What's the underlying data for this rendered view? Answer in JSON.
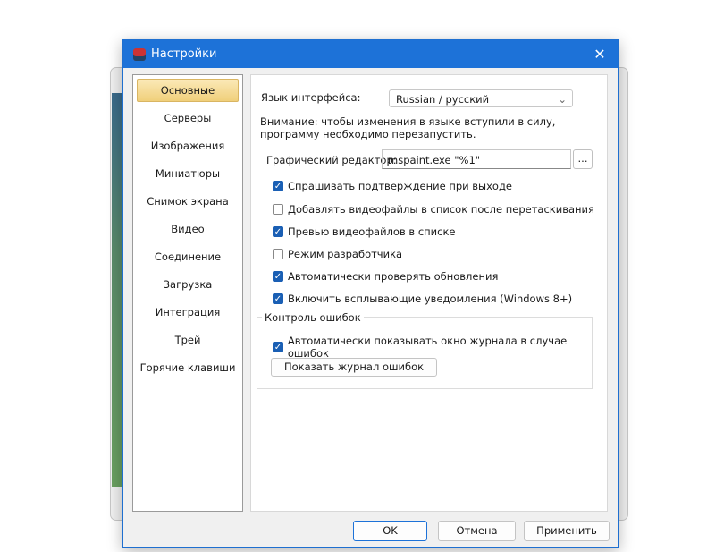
{
  "dialog": {
    "title": "Настройки"
  },
  "sidebar": {
    "items": [
      "Основные",
      "Серверы",
      "Изображения",
      "Миниатюры",
      "Снимок экрана",
      "Видео",
      "Соединение",
      "Загрузка",
      "Интеграция",
      "Трей",
      "Горячие клавиши"
    ]
  },
  "general": {
    "language_label": "Язык интерфейса:",
    "language_value": "Russian / русский",
    "warning": "Внимание: чтобы изменения в языке вступили в силу, программу необходимо перезапустить.",
    "editor_label": "Графический редактор:",
    "editor_value": "mspaint.exe \"%1\"",
    "browse": "...",
    "checkboxes": [
      {
        "label": "Спрашивать подтверждение при выходе",
        "checked": true
      },
      {
        "label": "Добавлять видеофайлы в список после перетаскивания",
        "checked": false
      },
      {
        "label": "Превью видеофайлов в списке",
        "checked": true
      },
      {
        "label": "Режим разработчика",
        "checked": false
      },
      {
        "label": "Автоматически проверять обновления",
        "checked": true
      },
      {
        "label": "Включить всплывающие уведомления (Windows 8+)",
        "checked": true
      }
    ],
    "errors_group": "Контроль ошибок",
    "errors_checkbox": {
      "label": "Автоматически показывать окно журнала в случае ошибок",
      "checked": true
    },
    "show_log": "Показать журнал ошибок"
  },
  "footer": {
    "ok": "OK",
    "cancel": "Отмена",
    "apply": "Применить"
  }
}
